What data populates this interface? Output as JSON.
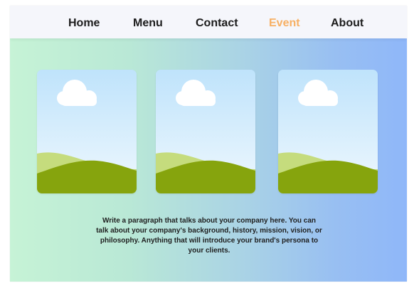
{
  "nav": {
    "items": [
      {
        "label": "Home",
        "active": false
      },
      {
        "label": "Menu",
        "active": false
      },
      {
        "label": "Contact",
        "active": false
      },
      {
        "label": "Event",
        "active": true
      },
      {
        "label": "About",
        "active": false
      }
    ]
  },
  "main": {
    "cards": [
      {
        "icon": "landscape-image-icon"
      },
      {
        "icon": "landscape-image-icon"
      },
      {
        "icon": "landscape-image-icon"
      }
    ],
    "intro_text": "Write a paragraph that talks about your company here. You can talk about your company's background, history, mission, vision, or philosophy. Anything that will introduce your brand's persona to your clients."
  },
  "colors": {
    "active_nav": "#f7b064",
    "nav_text": "#1c1c1c",
    "navbar_bg": "#f5f6fb",
    "gradient_start": "#c6f3d6",
    "gradient_end": "#8fb7f9",
    "sky_top": "#bfe3fb",
    "sky_bottom": "#eff8fe",
    "hill_light": "#c5dc7d",
    "hill_dark": "#86a40d"
  }
}
